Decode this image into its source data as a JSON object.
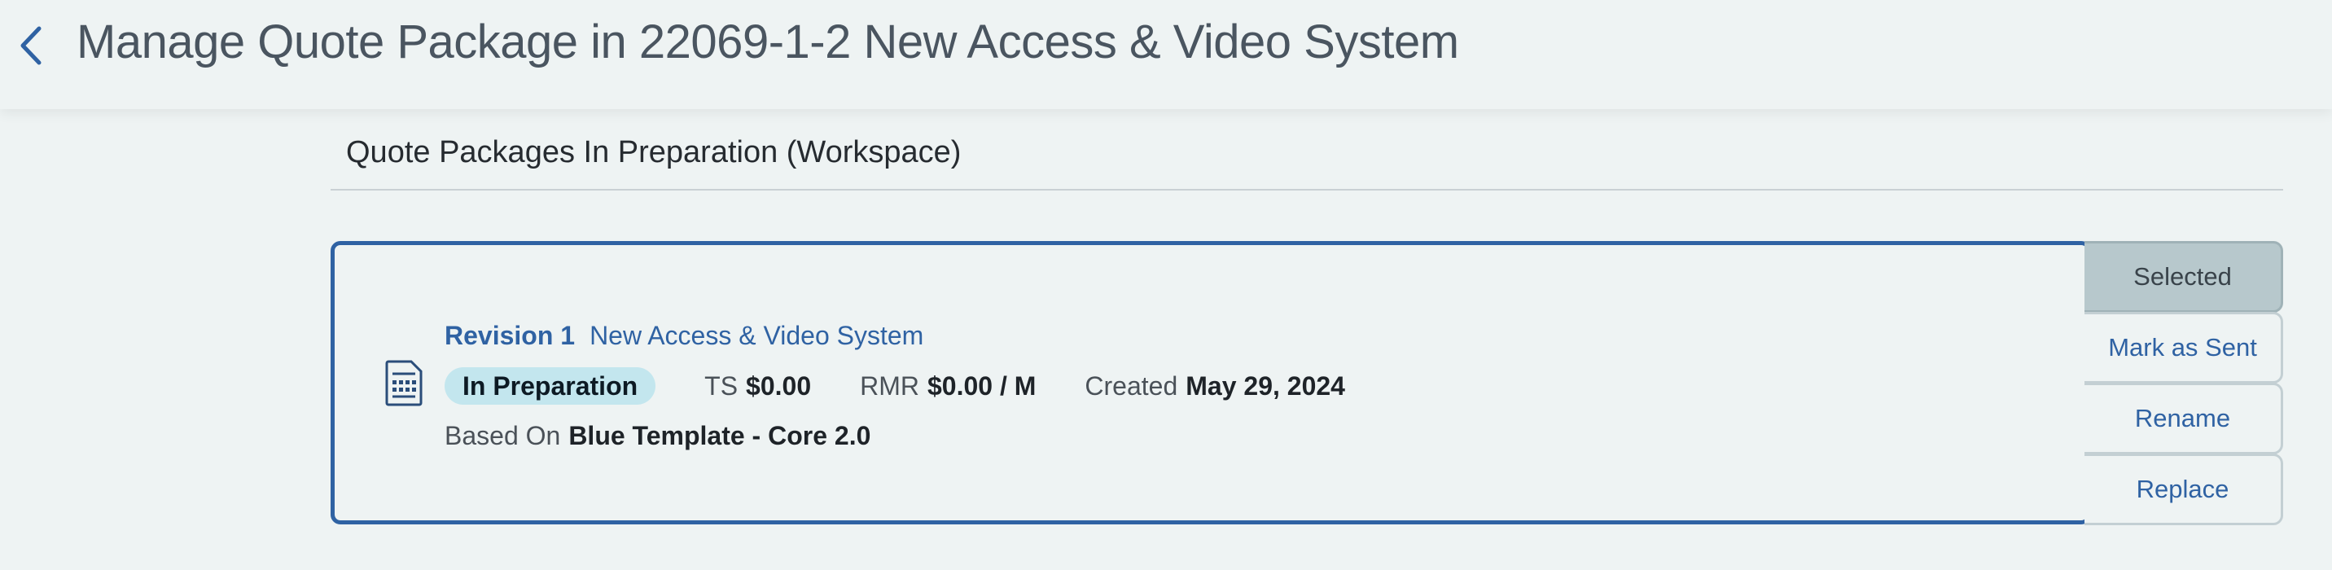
{
  "header": {
    "title": "Manage Quote Package in 22069-1-2 New Access & Video System"
  },
  "section": {
    "title": "Quote Packages In Preparation (Workspace)"
  },
  "package": {
    "revision_label": "Revision 1",
    "name": "New Access & Video System",
    "status": "In Preparation",
    "ts_label": "TS",
    "ts_value": "$0.00",
    "rmr_label": "RMR",
    "rmr_value": "$0.00 / M",
    "created_label": "Created",
    "created_value": "May 29, 2024",
    "based_on_label": "Based On",
    "based_on_value": "Blue Template - Core 2.0",
    "icon": "document-list-icon"
  },
  "actions": [
    {
      "label": "Selected",
      "state": "selected"
    },
    {
      "label": "Mark as Sent"
    },
    {
      "label": "Rename"
    },
    {
      "label": "Replace"
    }
  ],
  "colors": {
    "accent": "#2f62a3",
    "background": "#eef3f3",
    "status_badge": "#c3e6ee",
    "selected_tab": "#b7c8cc"
  }
}
